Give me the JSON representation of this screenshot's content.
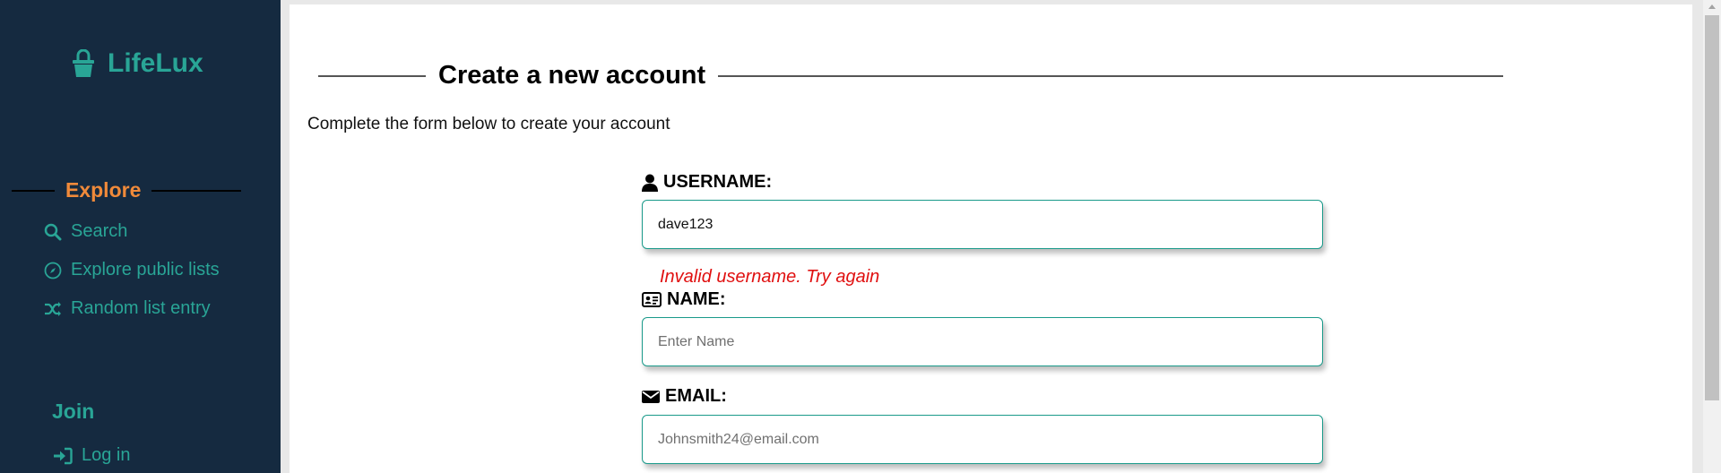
{
  "brand": {
    "name": "LifeLux",
    "icon": "basket-icon"
  },
  "sidebar": {
    "explore_heading": "Explore",
    "explore_items": [
      {
        "label": "Search",
        "icon": "search-icon"
      },
      {
        "label": "Explore public lists",
        "icon": "compass-icon"
      },
      {
        "label": "Random list entry",
        "icon": "shuffle-icon"
      }
    ],
    "join_heading": "Join",
    "join_items": [
      {
        "label": "Log in",
        "icon": "sign-in-icon"
      }
    ]
  },
  "page": {
    "title": "Create a new account",
    "subtitle": "Complete the form below to create your account"
  },
  "form": {
    "username": {
      "label": "USERNAME:",
      "value": "dave123",
      "icon": "user-icon"
    },
    "username_error": "Invalid username. Try again",
    "name": {
      "label": "NAME:",
      "placeholder": "Enter Name",
      "icon": "id-card-icon"
    },
    "email": {
      "label": "EMAIL:",
      "placeholder": "Johnsmith24@email.com",
      "icon": "envelope-icon"
    }
  },
  "colors": {
    "sidebar_bg": "#152a40",
    "accent": "#29a596",
    "explore_heading": "#f08a3a",
    "error": "#e01010"
  }
}
